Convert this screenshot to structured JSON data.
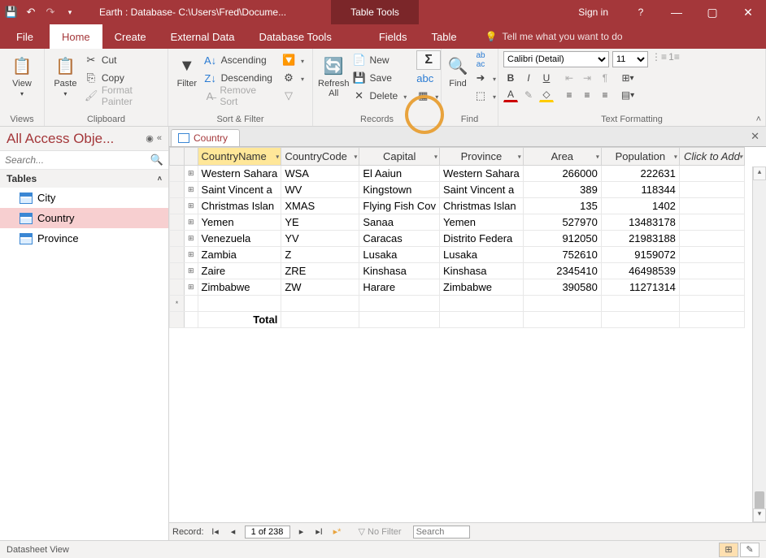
{
  "titlebar": {
    "title": "Earth : Database- C:\\Users\\Fred\\Docume...",
    "tool_tab": "Table Tools",
    "signin": "Sign in"
  },
  "tabs": {
    "file": "File",
    "home": "Home",
    "create": "Create",
    "external": "External Data",
    "dbtools": "Database Tools",
    "fields": "Fields",
    "table": "Table",
    "tellme": "Tell me what you want to do"
  },
  "ribbon": {
    "views": {
      "label": "Views",
      "view": "View"
    },
    "clipboard": {
      "label": "Clipboard",
      "paste": "Paste",
      "cut": "Cut",
      "copy": "Copy",
      "fmt": "Format Painter"
    },
    "sort": {
      "label": "Sort & Filter",
      "filter": "Filter",
      "asc": "Ascending",
      "desc": "Descending",
      "remove": "Remove Sort"
    },
    "records": {
      "label": "Records",
      "refresh": "Refresh All",
      "new": "New",
      "save": "Save",
      "delete": "Delete"
    },
    "find": {
      "label": "Find",
      "find": "Find"
    },
    "text": {
      "label": "Text Formatting",
      "font": "Calibri (Detail)",
      "size": "11"
    }
  },
  "nav": {
    "header": "All Access Obje...",
    "search_ph": "Search...",
    "group": "Tables",
    "items": [
      "City",
      "Country",
      "Province"
    ]
  },
  "datasheet": {
    "tab": "Country",
    "columns": [
      "CountryName",
      "CountryCode",
      "Capital",
      "Province",
      "Area",
      "Population"
    ],
    "addcol": "Click to Add",
    "rows": [
      {
        "name": "Western Sahara",
        "code": "WSA",
        "capital": "El Aaiun",
        "province": "Western Sahara",
        "area": 266000,
        "pop": 222631
      },
      {
        "name": "Saint Vincent a",
        "code": "WV",
        "capital": "Kingstown",
        "province": "Saint Vincent a",
        "area": 389,
        "pop": 118344
      },
      {
        "name": "Christmas Islan",
        "code": "XMAS",
        "capital": "Flying Fish Cov",
        "province": "Christmas Islan",
        "area": 135,
        "pop": 1402
      },
      {
        "name": "Yemen",
        "code": "YE",
        "capital": "Sanaa",
        "province": "Yemen",
        "area": 527970,
        "pop": 13483178
      },
      {
        "name": "Venezuela",
        "code": "YV",
        "capital": "Caracas",
        "province": "Distrito Federa",
        "area": 912050,
        "pop": 21983188
      },
      {
        "name": "Zambia",
        "code": "Z",
        "capital": "Lusaka",
        "province": "Lusaka",
        "area": 752610,
        "pop": 9159072
      },
      {
        "name": "Zaire",
        "code": "ZRE",
        "capital": "Kinshasa",
        "province": "Kinshasa",
        "area": 2345410,
        "pop": 46498539
      },
      {
        "name": "Zimbabwe",
        "code": "ZW",
        "capital": "Harare",
        "province": "Zimbabwe",
        "area": 390580,
        "pop": 11271314
      }
    ],
    "total_label": "Total",
    "recnav": {
      "label": "Record:",
      "pos": "1 of 238",
      "nofilter": "No Filter",
      "search": "Search"
    }
  },
  "status": {
    "view": "Datasheet View"
  }
}
